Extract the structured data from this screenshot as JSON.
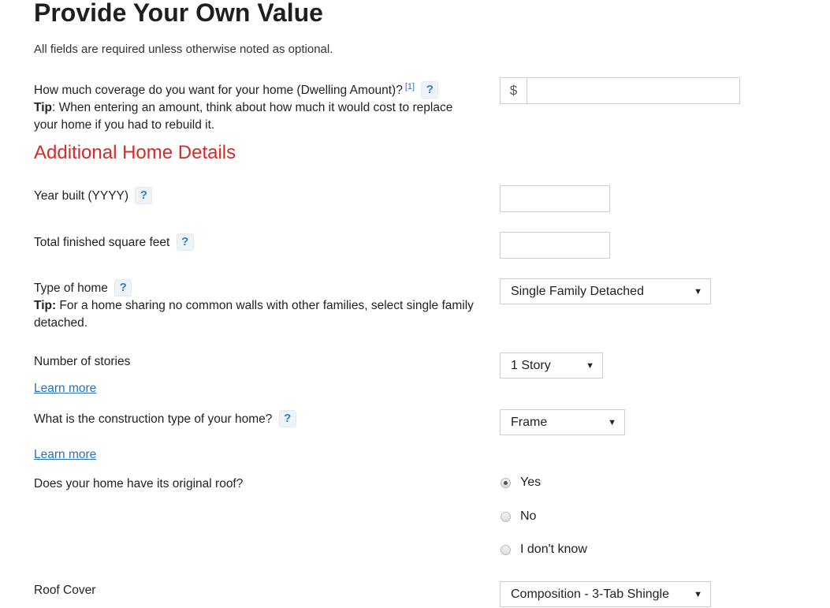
{
  "page": {
    "title": "Provide Your Own Value",
    "subtitle": "All fields are required unless otherwise noted as optional."
  },
  "dwelling": {
    "label": "How much coverage do you want for your home (Dwelling Amount)?",
    "footnote": "[1]",
    "help_icon": "?",
    "tip_bold": "Tip",
    "tip_text": ": When entering an amount, think about how much it would cost to replace your home if you had to rebuild it.",
    "currency_symbol": "$",
    "value": ""
  },
  "section": {
    "title": "Additional Home Details"
  },
  "fields": {
    "year_built": {
      "label": "Year built (YYYY)",
      "help_icon": "?",
      "value": ""
    },
    "square_feet": {
      "label": "Total finished square feet",
      "help_icon": "?",
      "value": ""
    },
    "type_of_home": {
      "label": "Type of home",
      "help_icon": "?",
      "tip_bold": "Tip:",
      "tip_text": " For a home sharing no common walls with other families, select single family detached.",
      "selected": "Single Family Detached",
      "caret": "▼"
    },
    "stories": {
      "label": "Number of stories",
      "learn_more": "Learn more",
      "selected": "1 Story",
      "caret": "▼"
    },
    "construction": {
      "label": "What is the construction type of your home?",
      "help_icon": "?",
      "learn_more": "Learn more",
      "selected": "Frame",
      "caret": "▼"
    },
    "original_roof": {
      "label": "Does your home have its original roof?",
      "options": [
        {
          "label": "Yes",
          "checked": true
        },
        {
          "label": "No",
          "checked": false
        },
        {
          "label": "I don't know",
          "checked": false
        }
      ]
    },
    "roof_cover": {
      "label": "Roof Cover",
      "selected": "Composition - 3-Tab Shingle",
      "caret": "▼"
    }
  }
}
